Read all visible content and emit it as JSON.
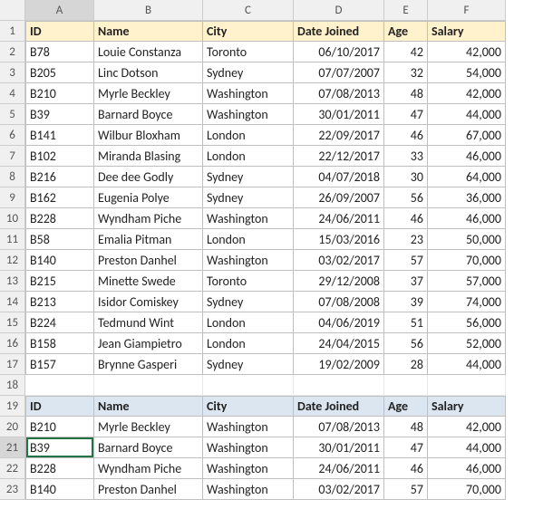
{
  "columns": [
    "A",
    "B",
    "C",
    "D",
    "E",
    "F"
  ],
  "rowCount": 23,
  "activeCell": {
    "row": 21,
    "col": "A"
  },
  "table1": {
    "headerRow": 1,
    "headers": [
      "ID",
      "Name",
      "City",
      "Date Joined",
      "Age",
      "Salary"
    ],
    "rows": [
      {
        "id": "B78",
        "name": "Louie Constanza",
        "city": "Toronto",
        "date": "06/10/2017",
        "age": "42",
        "salary": "42,000"
      },
      {
        "id": "B205",
        "name": "Linc Dotson",
        "city": "Sydney",
        "date": "07/07/2007",
        "age": "32",
        "salary": "54,000"
      },
      {
        "id": "B210",
        "name": "Myrle Beckley",
        "city": "Washington",
        "date": "07/08/2013",
        "age": "48",
        "salary": "42,000"
      },
      {
        "id": "B39",
        "name": "Barnard Boyce",
        "city": "Washington",
        "date": "30/01/2011",
        "age": "47",
        "salary": "44,000"
      },
      {
        "id": "B141",
        "name": "Wilbur Bloxham",
        "city": "London",
        "date": "22/09/2017",
        "age": "46",
        "salary": "67,000"
      },
      {
        "id": "B102",
        "name": "Miranda Blasing",
        "city": "London",
        "date": "22/12/2017",
        "age": "33",
        "salary": "46,000"
      },
      {
        "id": "B216",
        "name": "Dee dee Godly",
        "city": "Sydney",
        "date": "04/07/2018",
        "age": "30",
        "salary": "64,000"
      },
      {
        "id": "B162",
        "name": "Eugenia Polye",
        "city": "Sydney",
        "date": "26/09/2007",
        "age": "56",
        "salary": "36,000"
      },
      {
        "id": "B228",
        "name": "Wyndham Piche",
        "city": "Washington",
        "date": "24/06/2011",
        "age": "46",
        "salary": "46,000"
      },
      {
        "id": "B58",
        "name": "Emalia Pitman",
        "city": "London",
        "date": "15/03/2016",
        "age": "23",
        "salary": "50,000"
      },
      {
        "id": "B140",
        "name": "Preston Danhel",
        "city": "Washington",
        "date": "03/02/2017",
        "age": "57",
        "salary": "70,000"
      },
      {
        "id": "B215",
        "name": "Minette Swede",
        "city": "Toronto",
        "date": "29/12/2008",
        "age": "37",
        "salary": "57,000"
      },
      {
        "id": "B213",
        "name": "Isidor Comiskey",
        "city": "Sydney",
        "date": "07/08/2008",
        "age": "39",
        "salary": "74,000"
      },
      {
        "id": "B224",
        "name": "Tedmund Wint",
        "city": "London",
        "date": "04/06/2019",
        "age": "51",
        "salary": "56,000"
      },
      {
        "id": "B158",
        "name": "Jean Giampietro",
        "city": "London",
        "date": "24/04/2015",
        "age": "56",
        "salary": "52,000"
      },
      {
        "id": "B157",
        "name": "Brynne Gasperi",
        "city": "Sydney",
        "date": "19/02/2009",
        "age": "28",
        "salary": "44,000"
      }
    ]
  },
  "table2": {
    "headerRow": 19,
    "headers": [
      "ID",
      "Name",
      "City",
      "Date Joined",
      "Age",
      "Salary"
    ],
    "rows": [
      {
        "id": "B210",
        "name": "Myrle Beckley",
        "city": "Washington",
        "date": "07/08/2013",
        "age": "48",
        "salary": "42,000"
      },
      {
        "id": "B39",
        "name": "Barnard Boyce",
        "city": "Washington",
        "date": "30/01/2011",
        "age": "47",
        "salary": "44,000"
      },
      {
        "id": "B228",
        "name": "Wyndham Piche",
        "city": "Washington",
        "date": "24/06/2011",
        "age": "46",
        "salary": "46,000"
      },
      {
        "id": "B140",
        "name": "Preston Danhel",
        "city": "Washington",
        "date": "03/02/2017",
        "age": "57",
        "salary": "70,000"
      }
    ]
  }
}
